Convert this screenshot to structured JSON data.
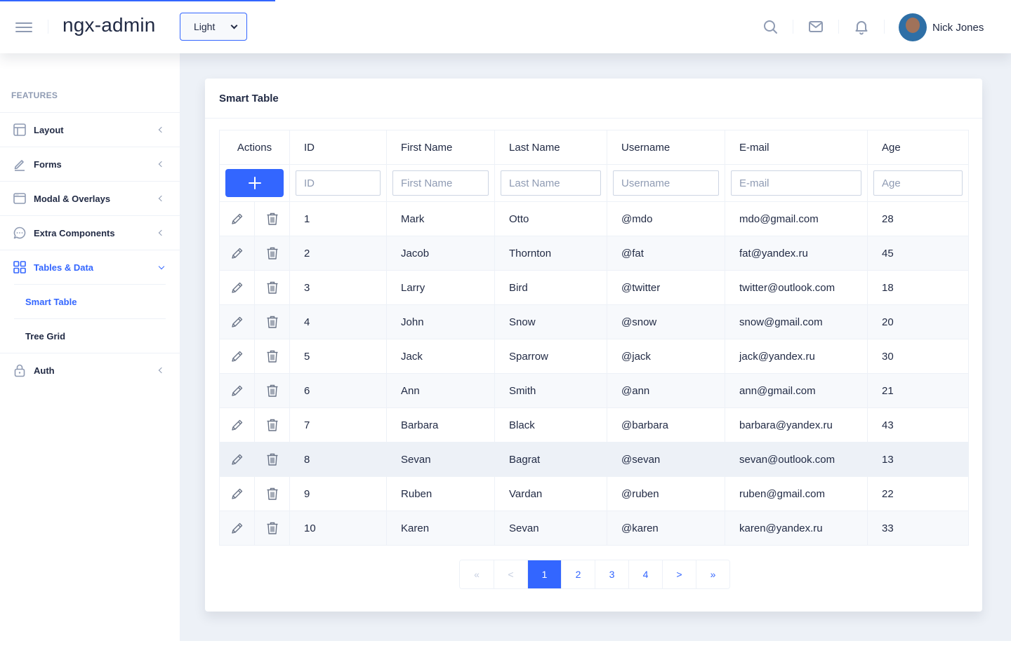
{
  "header": {
    "brand": "ngx-admin",
    "theme_value": "Light",
    "user_name": "Nick Jones"
  },
  "sidebar": {
    "heading": "FEATURES",
    "items": [
      {
        "label": "Layout",
        "icon": "layout-icon"
      },
      {
        "label": "Forms",
        "icon": "edit-icon"
      },
      {
        "label": "Modal & Overlays",
        "icon": "browser-icon"
      },
      {
        "label": "Extra Components",
        "icon": "message-circle-icon"
      },
      {
        "label": "Tables & Data",
        "icon": "grid-icon"
      },
      {
        "label": "Auth",
        "icon": "lock-icon"
      }
    ],
    "sub_items": [
      {
        "label": "Smart Table"
      },
      {
        "label": "Tree Grid"
      }
    ]
  },
  "card": {
    "title": "Smart Table"
  },
  "table": {
    "headers": {
      "actions": "Actions",
      "id": "ID",
      "first_name": "First Name",
      "last_name": "Last Name",
      "username": "Username",
      "email": "E-mail",
      "age": "Age"
    },
    "placeholders": {
      "id": "ID",
      "first_name": "First Name",
      "last_name": "Last Name",
      "username": "Username",
      "email": "E-mail",
      "age": "Age"
    },
    "rows": [
      {
        "id": "1",
        "first": "Mark",
        "last": "Otto",
        "user": "@mdo",
        "email": "mdo@gmail.com",
        "age": "28"
      },
      {
        "id": "2",
        "first": "Jacob",
        "last": "Thornton",
        "user": "@fat",
        "email": "fat@yandex.ru",
        "age": "45"
      },
      {
        "id": "3",
        "first": "Larry",
        "last": "Bird",
        "user": "@twitter",
        "email": "twitter@outlook.com",
        "age": "18"
      },
      {
        "id": "4",
        "first": "John",
        "last": "Snow",
        "user": "@snow",
        "email": "snow@gmail.com",
        "age": "20"
      },
      {
        "id": "5",
        "first": "Jack",
        "last": "Sparrow",
        "user": "@jack",
        "email": "jack@yandex.ru",
        "age": "30"
      },
      {
        "id": "6",
        "first": "Ann",
        "last": "Smith",
        "user": "@ann",
        "email": "ann@gmail.com",
        "age": "21"
      },
      {
        "id": "7",
        "first": "Barbara",
        "last": "Black",
        "user": "@barbara",
        "email": "barbara@yandex.ru",
        "age": "43"
      },
      {
        "id": "8",
        "first": "Sevan",
        "last": "Bagrat",
        "user": "@sevan",
        "email": "sevan@outlook.com",
        "age": "13"
      },
      {
        "id": "9",
        "first": "Ruben",
        "last": "Vardan",
        "user": "@ruben",
        "email": "ruben@gmail.com",
        "age": "22"
      },
      {
        "id": "10",
        "first": "Karen",
        "last": "Sevan",
        "user": "@karen",
        "email": "karen@yandex.ru",
        "age": "33"
      }
    ]
  },
  "pager": {
    "first": "«",
    "prev": "<",
    "pages": [
      "1",
      "2",
      "3",
      "4"
    ],
    "next": ">",
    "last": "»",
    "active_page": "1"
  },
  "colors": {
    "primary": "#3366ff",
    "background": "#edf1f7",
    "text": "#222b45",
    "hint": "#8f9bb3"
  }
}
